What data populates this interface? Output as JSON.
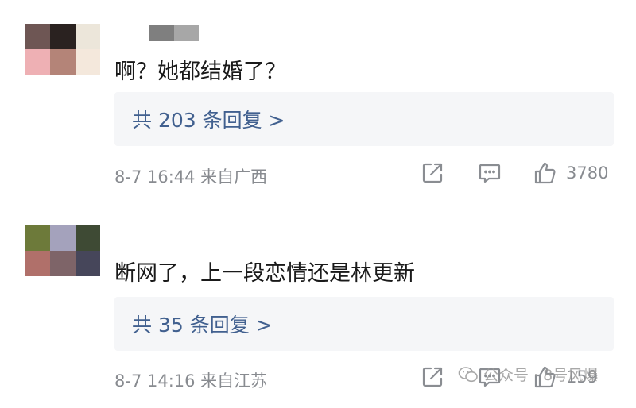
{
  "comments": [
    {
      "avatar_colors": [
        "#6e5654",
        "#2a2220",
        "#ece6da",
        "#eeb0b4",
        "#b48478",
        "#f4e8dc"
      ],
      "username_blur_colors": [
        "#7f7f7f",
        "#a7a7a7"
      ],
      "text": "啊？她都结婚了？",
      "replies_label": "共 203 条回复 >",
      "meta": "8-7 16:44  来自广西",
      "like_count": "3780"
    },
    {
      "avatar_colors": [
        "#6d7a3a",
        "#a4a2bc",
        "#3e4a34",
        "#b0706a",
        "#7e6468",
        "#46465a"
      ],
      "text": "断网了，上一段恋情还是林更新",
      "replies_label": "共 35 条回复 >",
      "meta": "8-7 14:16  来自江苏",
      "like_count": "159"
    }
  ],
  "watermark": {
    "text": "公众号 · 8号风爆",
    "icon": "wechat-icon"
  }
}
